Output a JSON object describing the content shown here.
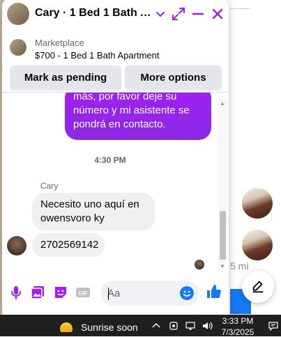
{
  "colors": {
    "accent": "#a11df4",
    "messenger_blue": "#1877f2",
    "bubble_in": "#f0f0f0",
    "taskbar": "#1f1f1f"
  },
  "background": {
    "distance_fragment": "5 mi"
  },
  "chat": {
    "title": "Cary · 1 Bed 1 Bath Ap...",
    "header_icons": [
      "chevron-down-icon",
      "expand-icon",
      "minimize-icon",
      "close-icon"
    ],
    "marketplace": {
      "label": "Marketplace",
      "listing": "$700 - 1 Bed 1 Bath Apartment",
      "mark_pending_label": "Mark as pending",
      "more_options_label": "More options"
    },
    "messages": {
      "outgoing_text": "más, por favor deje su\nnúmero y mi asistente se\npondrá en contacto.",
      "timestamp": "4:30 PM",
      "sender_name": "Cary",
      "incoming": [
        "Necesito uno aquí en\nowensvoro ky",
        "2702569142"
      ]
    },
    "composer": {
      "placeholder": "Aa",
      "icons": [
        "microphone-icon",
        "photo-icon",
        "sticker-icon",
        "gif-icon",
        "emoji-icon",
        "thumbs-up-icon"
      ]
    }
  },
  "taskbar": {
    "weather_text": "Sunrise soon",
    "time": "3:33 PM",
    "date": "7/3/2025"
  }
}
